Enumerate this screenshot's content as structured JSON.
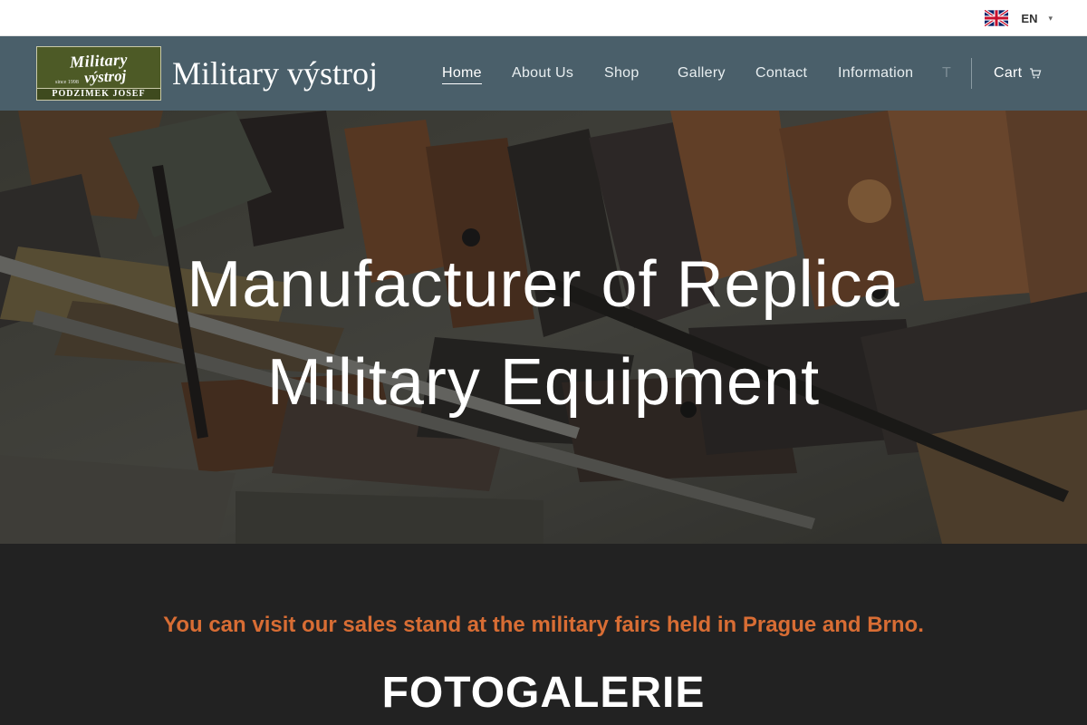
{
  "topbar": {
    "language_code": "EN",
    "language_caret": "▾",
    "flag_icon": "uk-flag-icon"
  },
  "header": {
    "logo": {
      "line1": "Military",
      "line2": "výstroj",
      "since": "since 1998",
      "bottom": "PODZIMEK JOSEF"
    },
    "site_title": "Military výstroj",
    "nav": [
      {
        "label": "Home",
        "active": true
      },
      {
        "label": "About Us",
        "active": false
      },
      {
        "label": "Shop",
        "active": false
      },
      {
        "label": "Gallery",
        "active": false
      },
      {
        "label": "Contact",
        "active": false
      },
      {
        "label": "Information",
        "active": false
      }
    ],
    "nav_overflow": "T",
    "cart_label": "Cart",
    "cart_icon": "cart-icon"
  },
  "hero": {
    "title_line1": "Manufacturer of Replica",
    "title_line2": "Military Equipment"
  },
  "content": {
    "notice": "You can visit our sales stand at the military fairs held in Prague and Brno.",
    "gallery_heading": "FOTOGALERIE"
  },
  "colors": {
    "header_bg": "#4a5f6a",
    "accent": "#d86d34",
    "page_bg": "#222222"
  }
}
